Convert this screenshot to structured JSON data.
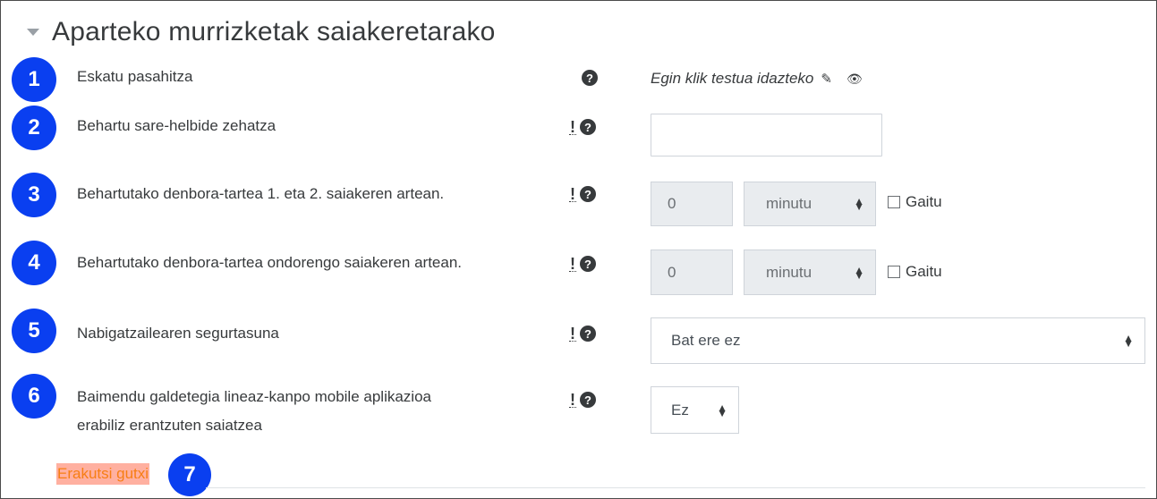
{
  "section": {
    "title": "Aparteko murrizketak saiakeretarako"
  },
  "rows": [
    {
      "badge": "1",
      "label": "Eskatu pasahitza"
    },
    {
      "badge": "2",
      "label": "Behartu sare-helbide zehatza"
    },
    {
      "badge": "3",
      "label": "Behartutako denbora-tartea 1. eta 2. saiakeren artean."
    },
    {
      "badge": "4",
      "label": "Behartutako denbora-tartea ondorengo saiakeren artean."
    },
    {
      "badge": "5",
      "label": "Nabigatzailearen segurtasuna"
    },
    {
      "badge": "6",
      "label_line1": "Baimendu galdetegia lineaz-kanpo mobile aplikazioa",
      "label_line2": "erabiliz erantzuten saiatzea"
    }
  ],
  "password": {
    "placeholder_text": "Egin klik testua idazteko"
  },
  "delay1": {
    "value": "0",
    "unit": "minutu",
    "enable_label": "Gaitu"
  },
  "delay2": {
    "value": "0",
    "unit": "minutu",
    "enable_label": "Gaitu"
  },
  "browser_security": {
    "selected": "Bat ere ez"
  },
  "offline_attempts": {
    "selected": "Ez"
  },
  "show_less": {
    "label": "Erakutsi gutxi",
    "badge": "7"
  },
  "icons": {
    "collapse": "chevron-down-icon",
    "help": "question-circle-icon",
    "advanced": "exclamation-icon",
    "edit": "pencil-icon",
    "reveal": "eye-icon"
  },
  "colors": {
    "badge": "#0a3ff0",
    "link": "#f77e14",
    "link_highlight": "#ffb0a0"
  }
}
